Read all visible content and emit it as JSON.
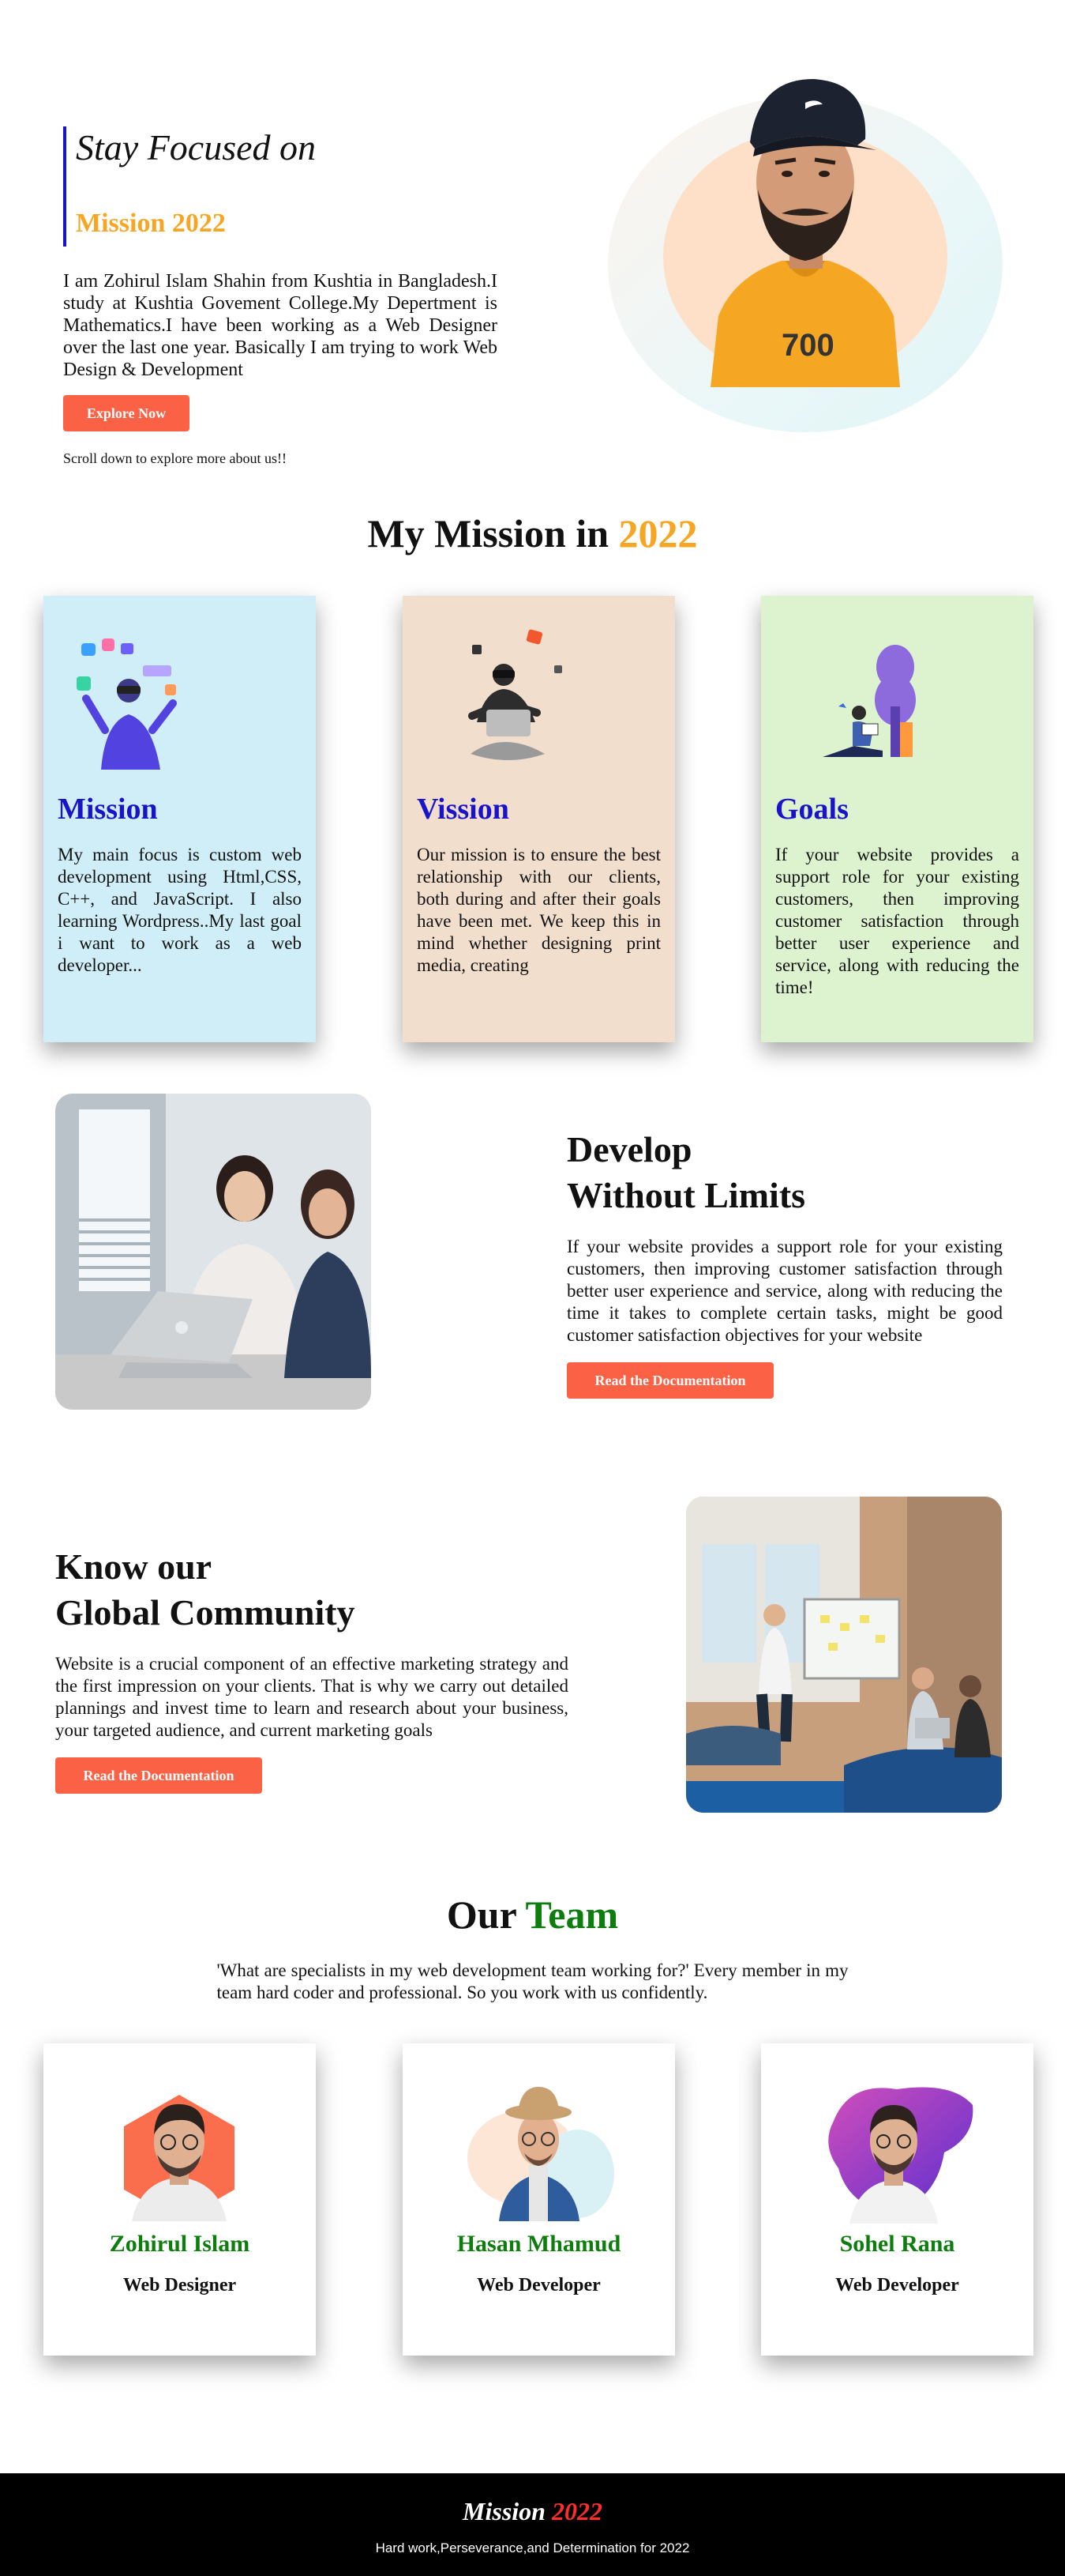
{
  "hero": {
    "title": "Stay Focused on",
    "subtitle": "Mission 2022",
    "description": "I am Zohirul Islam Shahin from Kushtia in Bangladesh.I study at Kushtia Govement College.My Depertment is Mathematics.I have been working as a Web Designer over the last one year. Basically I am trying to work Web Design & Development",
    "cta": "Explore Now",
    "note": "Scroll down to explore more about us!!"
  },
  "mission": {
    "title_main": "My Mission in",
    "title_accent": "2022",
    "cards": [
      {
        "heading": "Mission",
        "text": "My main focus is custom web development using Html,CSS, C++, and JavaScript. I also learning Wordpress..My last goal i want to work as a web developer...",
        "bg": "#cfeef8"
      },
      {
        "heading": "Vission",
        "text": "Our mission is to ensure the best relationship with our clients, both during and after their goals have been met. We keep this in mind whether designing print media, creating",
        "bg": "#f1decd"
      },
      {
        "heading": "Goals",
        "text": "If your website provides a support role for your existing customers, then improving customer satisfaction through better user experience and service, along with reducing the time!",
        "bg": "#ddf2cf"
      }
    ]
  },
  "develop": {
    "title_line1": "Develop",
    "title_line2": "Without Limits",
    "text": "If your website provides a support role for your existing customers, then improving customer satisfaction through better user experience and service, along with reducing the time it takes to complete certain tasks, might be good customer satisfaction objectives for your website",
    "cta": "Read the Documentation"
  },
  "community": {
    "title_line1": "Know our",
    "title_line2": "Global Community",
    "text": "Website is a crucial component of an effective marketing strategy and the first impression on your clients. That is why we carry out detailed plannings and invest time to learn and research about your business, your targeted audience, and current marketing goals",
    "cta": "Read the Documentation"
  },
  "team": {
    "title_main": "Our",
    "title_accent": "Team",
    "intro": "'What are specialists in my web development team working for?' Every member in my team hard coder and professional. So you work with us confidently.",
    "members": [
      {
        "name": "Zohirul Islam",
        "role": "Web Designer"
      },
      {
        "name": "Hasan Mhamud",
        "role": "Web Developer"
      },
      {
        "name": "Sohel Rana",
        "role": "Web Developer"
      }
    ]
  },
  "footer": {
    "brand": "Mission",
    "year": "2022",
    "tagline": "Hard work,Perseverance,and Determination for 2022"
  },
  "colors": {
    "accent_orange": "#f6a623",
    "accent_blue": "#1a14c9",
    "button": "#fb6245",
    "team_green": "#0d7d0d",
    "footer_bg": "#000000"
  }
}
